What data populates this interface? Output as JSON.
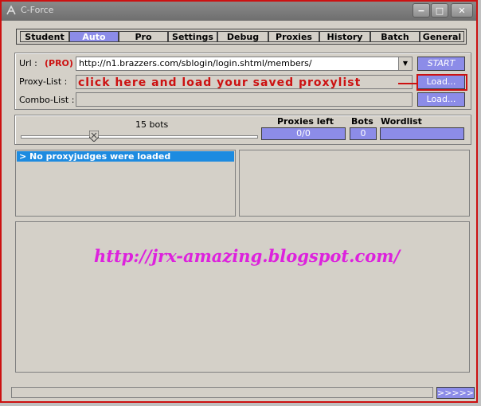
{
  "window": {
    "title": "C-Force"
  },
  "titlebar_buttons": {
    "minimize": "−",
    "maximize": "□",
    "close": "✕"
  },
  "tabs": [
    {
      "label": "Student",
      "active": false
    },
    {
      "label": "Auto",
      "active": true
    },
    {
      "label": "Pro",
      "active": false
    },
    {
      "label": "Settings",
      "active": false
    },
    {
      "label": "Debug",
      "active": false
    },
    {
      "label": "Proxies",
      "active": false
    },
    {
      "label": "History",
      "active": false
    },
    {
      "label": "Batch",
      "active": false
    },
    {
      "label": "General",
      "active": false
    }
  ],
  "form": {
    "url_label": "Url :",
    "pro_badge": "(PRO)",
    "url_value": "http://n1.brazzers.com/sblogin/login.shtml/members/",
    "start_label": "START",
    "proxy_label": "Proxy-List :",
    "proxy_value": "",
    "combo_label": "Combo-List :",
    "combo_value": "",
    "load_label": "Load...",
    "annotation": "click here and load your saved proxylist"
  },
  "stats": {
    "bots_label": "15 bots",
    "slider_level": 0.3,
    "proxies_left_label": "Proxies left",
    "proxies_left_value": "0/0",
    "bots_header": "Bots",
    "bots_value": "0",
    "wordlist_label": "Wordlist progression",
    "wordlist_value": ""
  },
  "judges": {
    "message": "> No proxyjudges were loaded"
  },
  "watermark": "http://jrx-amazing.blogspot.com/",
  "footer": {
    "more_label": ">>>>>"
  },
  "colors": {
    "accent": "#8c8ce8",
    "highlight": "#cc1111",
    "selection": "#1d8be0",
    "watermark": "#dd22dd"
  }
}
